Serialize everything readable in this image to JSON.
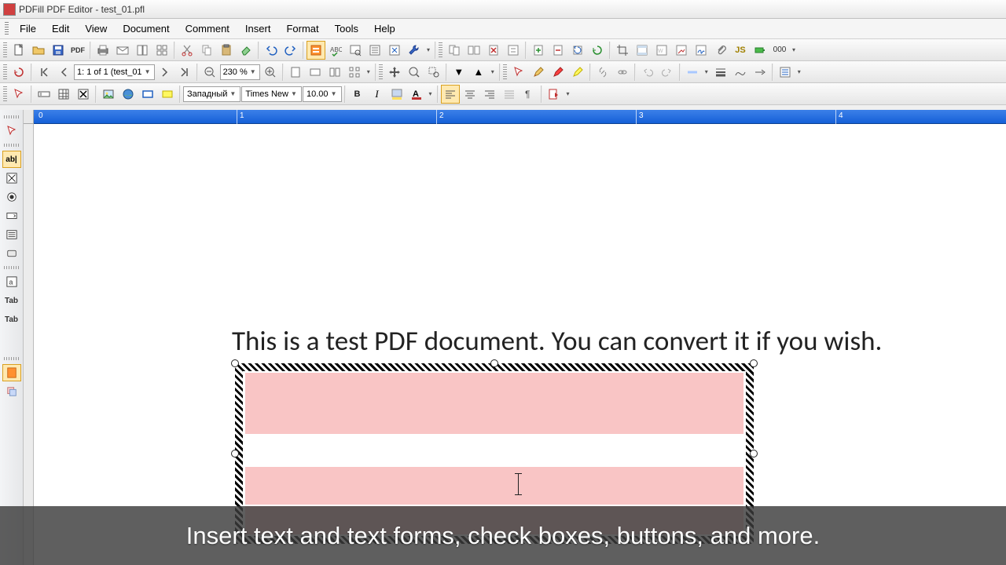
{
  "title": "PDFill PDF Editor - test_01.pfl",
  "menus": {
    "file": "File",
    "edit": "Edit",
    "view": "View",
    "document": "Document",
    "comment": "Comment",
    "insert": "Insert",
    "format": "Format",
    "tools": "Tools",
    "help": "Help"
  },
  "nav": {
    "page_display": "1: 1 of 1 (test_01",
    "zoom": "230 %"
  },
  "format_bar": {
    "lang": "Западный",
    "font": "Times New",
    "size": "10.00",
    "bold": "B",
    "italic": "I"
  },
  "toolbar_labels": {
    "pdf": "PDF",
    "js": "JS",
    "zeros": "000"
  },
  "sidebar": {
    "ab": "ab|",
    "tab": "Tab"
  },
  "ruler": {
    "t0": "0",
    "t1": "1",
    "t2": "2",
    "t3": "3",
    "t4": "4"
  },
  "document_text": "This is a test PDF document. You can convert it if you wish.",
  "caption": "Insert text and text forms, check boxes, buttons, and more."
}
